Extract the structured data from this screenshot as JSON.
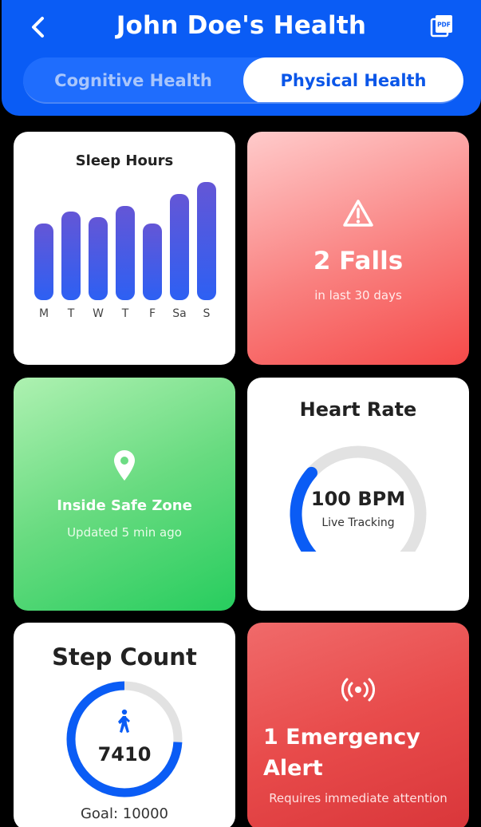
{
  "header": {
    "title": "John Doe's Health",
    "back_icon": "chevron-left-icon",
    "pdf_icon": "pdf-export-icon",
    "pdf_icon_text": "PDF",
    "background": "#0a5cf5"
  },
  "tabs": [
    {
      "label": "Cognitive Health",
      "active": false
    },
    {
      "label": "Physical Health",
      "active": true
    }
  ],
  "sleep_card": {
    "title": "Sleep Hours",
    "chart_data": {
      "type": "bar",
      "categories": [
        "M",
        "T",
        "W",
        "T",
        "F",
        "Sa",
        "S"
      ],
      "values": [
        6.5,
        7.5,
        7.0,
        8.0,
        6.5,
        9.0,
        10.0
      ],
      "title": "Sleep Hours",
      "xlabel": "",
      "ylabel": "",
      "grid": false,
      "color_top": "#6456d6",
      "color_bottom": "#2d60f3"
    }
  },
  "falls_card": {
    "icon": "warning-triangle-icon",
    "value": "2 Falls",
    "subtitle": "in last 30 days"
  },
  "safe_zone_card": {
    "icon": "location-pin-icon",
    "title": "Inside Safe Zone",
    "subtitle": "Updated 5 min ago"
  },
  "heart_rate_card": {
    "title": "Heart Rate",
    "value": "100 BPM",
    "subtitle": "Live Tracking",
    "gauge_fraction": 0.32,
    "accent": "#0a5cf5"
  },
  "step_card": {
    "title": "Step Count",
    "icon": "walking-person-icon",
    "value": "7410",
    "goal": "Goal: 10000",
    "progress_fraction": 0.741,
    "accent": "#0a5cf5"
  },
  "emergency_card": {
    "icon": "broadcast-signal-icon",
    "title": "1 Emergency Alert",
    "subtitle": "Requires immediate attention"
  }
}
